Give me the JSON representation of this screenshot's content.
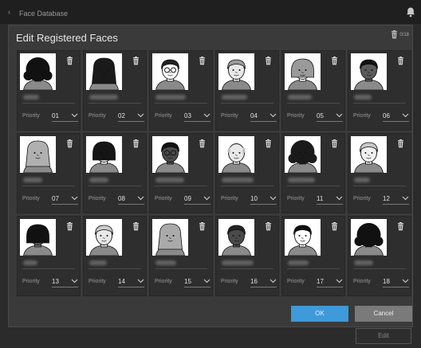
{
  "topbar": {
    "back_glyph": "‹",
    "title": "Face Database",
    "icon": "bell-icon"
  },
  "dialog": {
    "title": "Edit Registered Faces",
    "count": "0/18",
    "priority_label": "Priority",
    "ok_label": "OK",
    "cancel_label": "Cancel"
  },
  "background": {
    "edit_label": "Edit"
  },
  "colors": {
    "accent": "#3e9ad8",
    "dialog_bg": "#3a3a3a",
    "card_bg": "#2e2e2e"
  },
  "faces": [
    {
      "priority": "01",
      "skin": "#4a4a4a",
      "hair": "#111111",
      "style": "curly"
    },
    {
      "priority": "02",
      "skin": "#ffffff",
      "hair": "#1a1a1a",
      "style": "long"
    },
    {
      "priority": "03",
      "skin": "#ffffff",
      "hair": "#222222",
      "style": "glasses"
    },
    {
      "priority": "04",
      "skin": "#e8e8e8",
      "hair": "#9a9a9a",
      "style": "short"
    },
    {
      "priority": "05",
      "skin": "#ffffff",
      "hair": "#9a9a9a",
      "style": "bob"
    },
    {
      "priority": "06",
      "skin": "#5a5a5a",
      "hair": "#111111",
      "style": "short"
    },
    {
      "priority": "07",
      "skin": "#e0e0e0",
      "hair": "#b0b0b0",
      "style": "long"
    },
    {
      "priority": "08",
      "skin": "#ffffff",
      "hair": "#151515",
      "style": "bob"
    },
    {
      "priority": "09",
      "skin": "#4a4a4a",
      "hair": "#111111",
      "style": "glasses"
    },
    {
      "priority": "10",
      "skin": "#e8e8e8",
      "hair": "#ffffff",
      "style": "bald"
    },
    {
      "priority": "11",
      "skin": "#5a5a5a",
      "hair": "#1a1a1a",
      "style": "curly"
    },
    {
      "priority": "12",
      "skin": "#f0f0f0",
      "hair": "#c8c8c8",
      "style": "short"
    },
    {
      "priority": "13",
      "skin": "#6a6a6a",
      "hair": "#111111",
      "style": "bob"
    },
    {
      "priority": "14",
      "skin": "#e8e8e8",
      "hair": "#cccccc",
      "style": "short"
    },
    {
      "priority": "15",
      "skin": "#ffffff",
      "hair": "#aaaaaa",
      "style": "long"
    },
    {
      "priority": "16",
      "skin": "#4a4a4a",
      "hair": "#222222",
      "style": "short"
    },
    {
      "priority": "17",
      "skin": "#ffffff",
      "hair": "#111111",
      "style": "short"
    },
    {
      "priority": "18",
      "skin": "#4a4a4a",
      "hair": "#111111",
      "style": "curly"
    }
  ]
}
